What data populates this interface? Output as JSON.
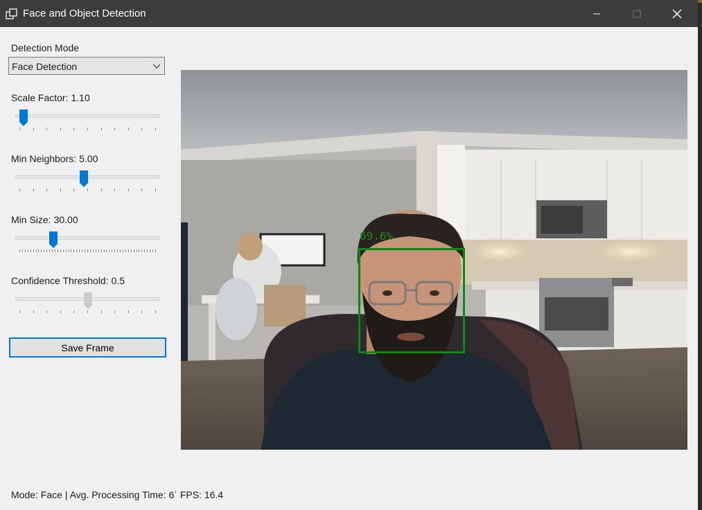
{
  "window": {
    "title": "Face and Object Detection",
    "icon": "app-windows-icon",
    "controls": [
      "minimize-icon",
      "maximize-icon",
      "close-icon"
    ]
  },
  "controls": {
    "mode_label": "Detection Mode",
    "mode_selected": "Face Detection",
    "scale": {
      "label": "Scale Factor:",
      "value": "1.10",
      "level": 0.03
    },
    "neighbors": {
      "label": "Min Neighbors:",
      "value": "5.00",
      "level": 0.47
    },
    "minsize": {
      "label": "Min Size:",
      "value": "30.00",
      "level": 0.25
    },
    "confidence": {
      "label": "Confidence Threshold:",
      "value": "0.5",
      "level": 0.5,
      "disabled": true
    },
    "save_label": "Save Frame"
  },
  "feed": {
    "detection_label": "69.6%",
    "box_color": "#0b8a12"
  },
  "status": "Mode: Face | Avg. Processing Time: 6ˈ FPS: 16.4",
  "colors": {
    "accent": "#0078d7",
    "titlebar": "#3c3c3c"
  }
}
